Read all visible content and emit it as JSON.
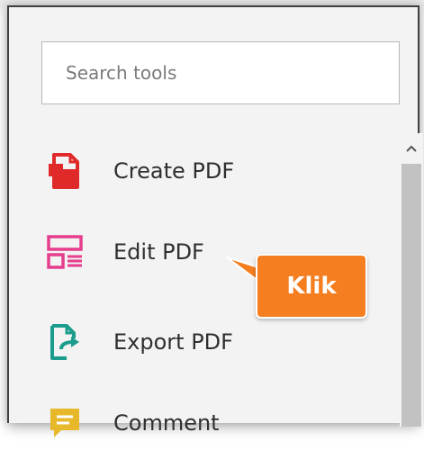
{
  "search": {
    "placeholder": "Search tools"
  },
  "tools": {
    "items": [
      {
        "label": "Create PDF",
        "icon": "create-pdf-icon",
        "color": "#e02a2a"
      },
      {
        "label": "Edit PDF",
        "icon": "edit-pdf-icon",
        "color": "#e63e8c"
      },
      {
        "label": "Export PDF",
        "icon": "export-pdf-icon",
        "color": "#1c9c8c"
      },
      {
        "label": "Comment",
        "icon": "comment-icon",
        "color": "#e6b82a"
      }
    ]
  },
  "callout": {
    "text": "Klik",
    "color": "#f47e20"
  },
  "scrollbar": {
    "up_icon": "chevron-up-icon"
  }
}
